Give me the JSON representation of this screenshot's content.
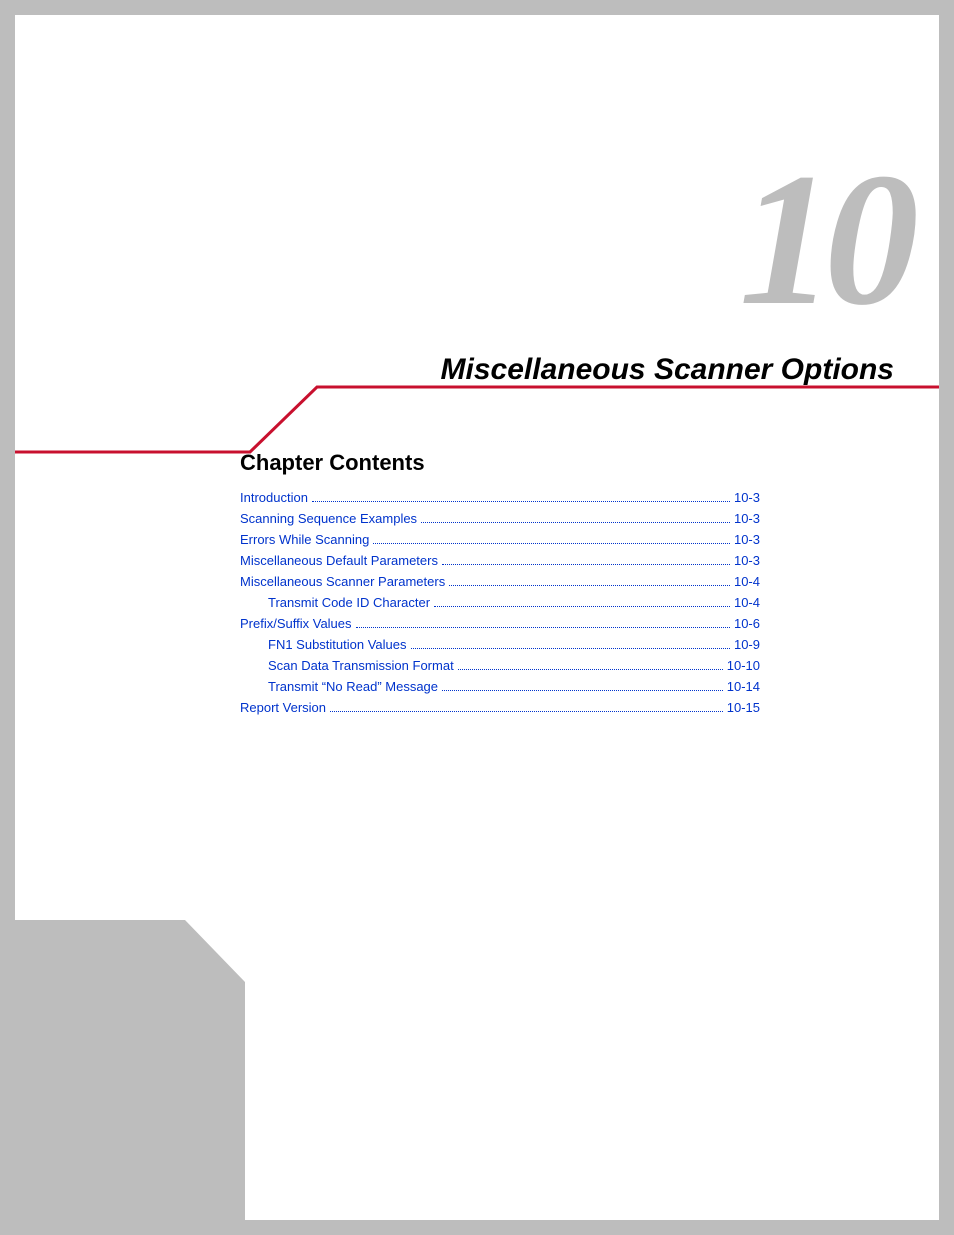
{
  "chapter_number": "10",
  "chapter_title": "Miscellaneous Scanner Options",
  "contents_heading": "Chapter Contents",
  "toc": [
    {
      "label": "Introduction",
      "page": "10-3",
      "indent": 0
    },
    {
      "label": "Scanning Sequence Examples",
      "page": "10-3",
      "indent": 0
    },
    {
      "label": "Errors While Scanning",
      "page": "10-3",
      "indent": 0
    },
    {
      "label": "Miscellaneous Default Parameters",
      "page": "10-3",
      "indent": 0
    },
    {
      "label": "Miscellaneous Scanner Parameters",
      "page": "10-4",
      "indent": 0
    },
    {
      "label": "Transmit Code ID Character",
      "page": "10-4",
      "indent": 1
    },
    {
      "label": "Prefix/Suffix Values",
      "page": "10-6",
      "indent": 0
    },
    {
      "label": "FN1 Substitution Values",
      "page": "10-9",
      "indent": 1
    },
    {
      "label": "Scan Data Transmission Format",
      "page": "10-10",
      "indent": 1
    },
    {
      "label": "Transmit “No Read” Message",
      "page": "10-14",
      "indent": 1
    },
    {
      "label": "Report Version",
      "page": "10-15",
      "indent": 0
    }
  ]
}
